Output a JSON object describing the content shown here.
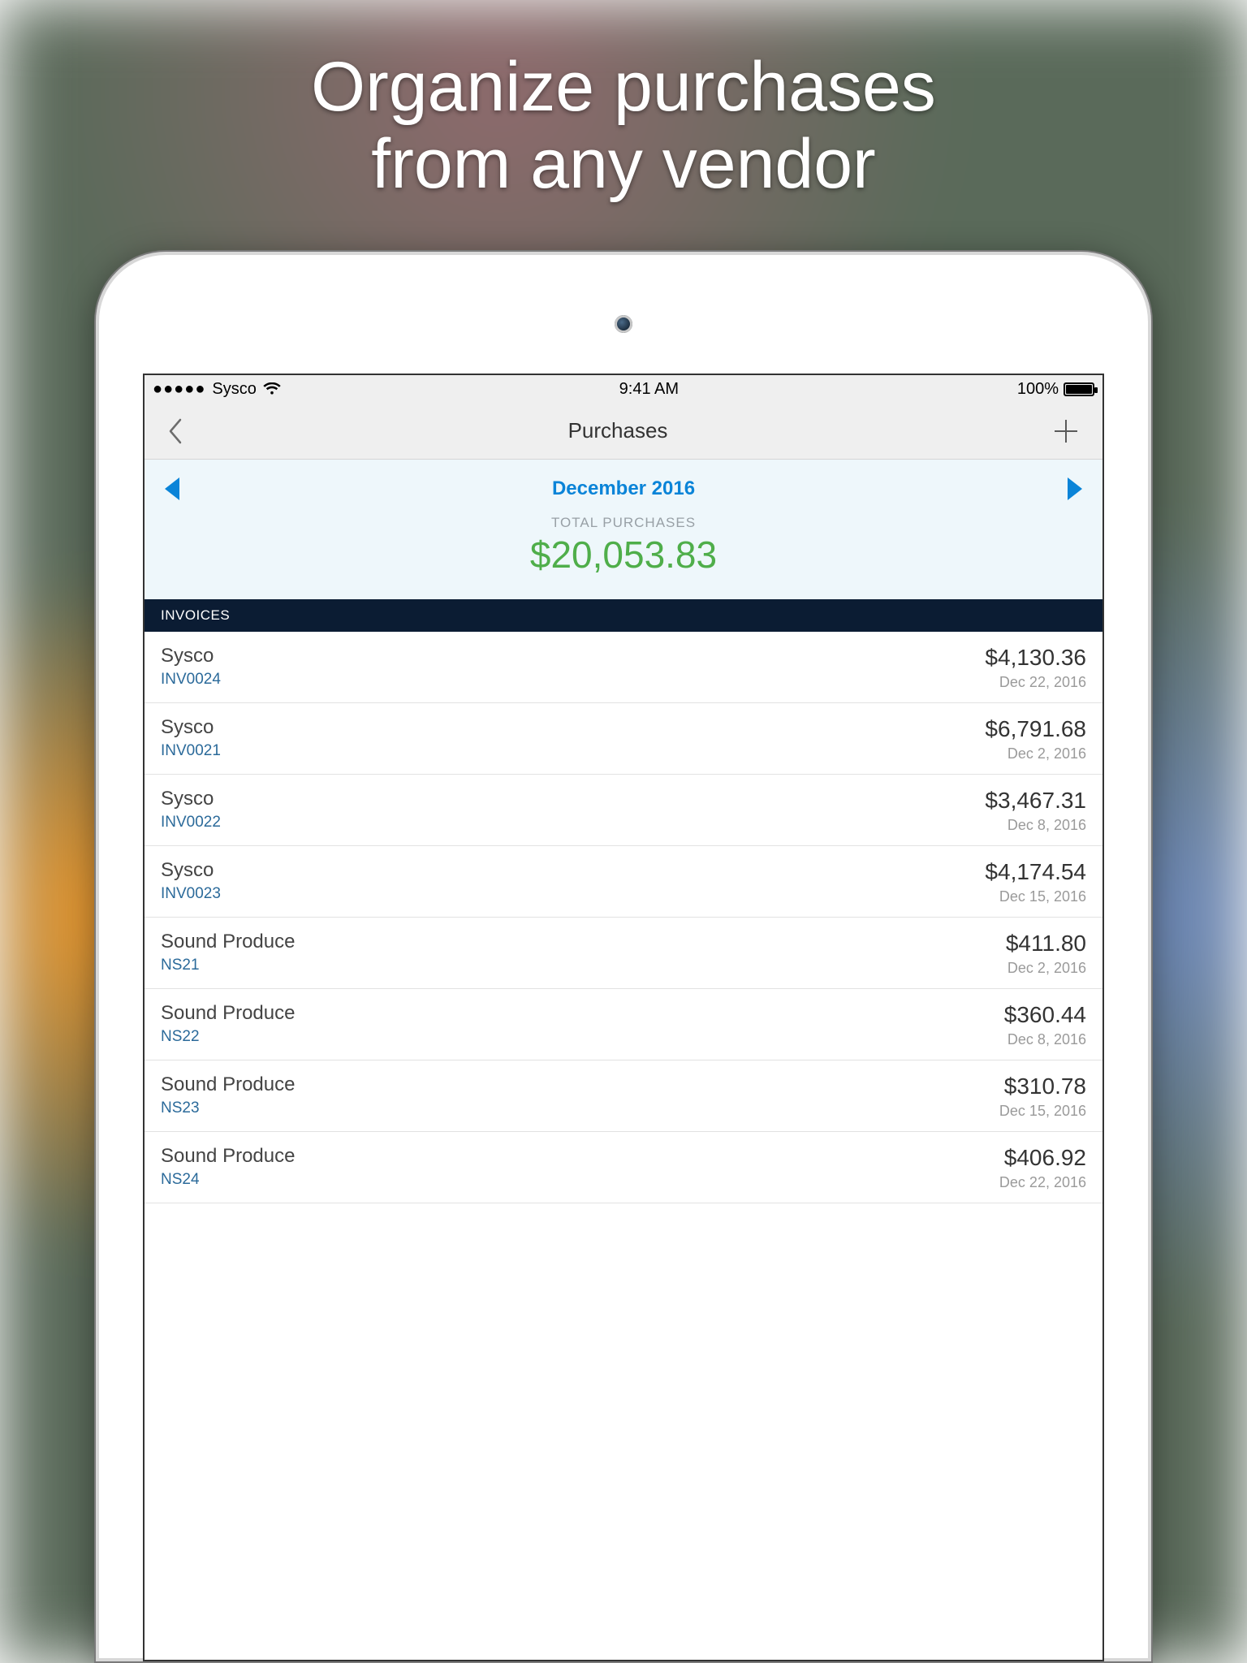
{
  "promo": {
    "line1": "Organize purchases",
    "line2": "from any vendor"
  },
  "statusbar": {
    "carrier": "Sysco",
    "time": "9:41 AM",
    "battery_pct": "100%"
  },
  "navbar": {
    "title": "Purchases"
  },
  "month_panel": {
    "month_label": "December 2016",
    "total_label": "TOTAL PURCHASES",
    "total_amount": "$20,053.83"
  },
  "section_header": "INVOICES",
  "invoices": [
    {
      "vendor": "Sysco",
      "inv": "INV0024",
      "amount": "$4,130.36",
      "date": "Dec 22, 2016"
    },
    {
      "vendor": "Sysco",
      "inv": "INV0021",
      "amount": "$6,791.68",
      "date": "Dec 2, 2016"
    },
    {
      "vendor": "Sysco",
      "inv": "INV0022",
      "amount": "$3,467.31",
      "date": "Dec 8, 2016"
    },
    {
      "vendor": "Sysco",
      "inv": "INV0023",
      "amount": "$4,174.54",
      "date": "Dec 15, 2016"
    },
    {
      "vendor": "Sound Produce",
      "inv": "NS21",
      "amount": "$411.80",
      "date": "Dec 2, 2016"
    },
    {
      "vendor": "Sound Produce",
      "inv": "NS22",
      "amount": "$360.44",
      "date": "Dec 8, 2016"
    },
    {
      "vendor": "Sound Produce",
      "inv": "NS23",
      "amount": "$310.78",
      "date": "Dec 15, 2016"
    },
    {
      "vendor": "Sound Produce",
      "inv": "NS24",
      "amount": "$406.92",
      "date": "Dec 22, 2016"
    }
  ]
}
